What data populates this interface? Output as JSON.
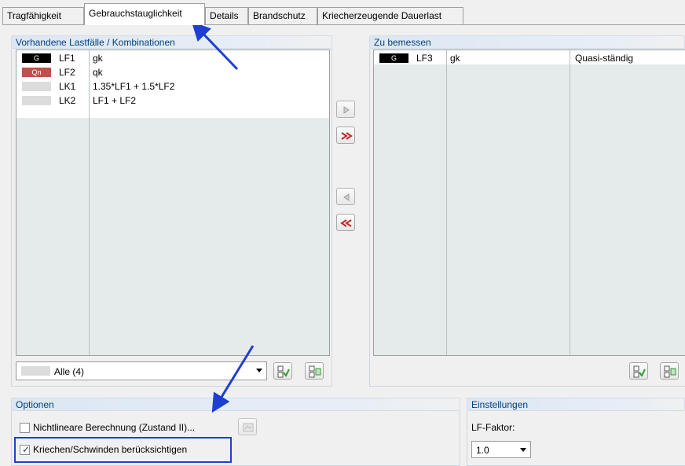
{
  "tabs": [
    {
      "label": "Tragfähigkeit"
    },
    {
      "label": "Gebrauchstauglichkeit"
    },
    {
      "label": "Details"
    },
    {
      "label": "Brandschutz"
    },
    {
      "label": "Kriecherzeugende Dauerlast"
    }
  ],
  "available": {
    "header": "Vorhandene Lastfälle / Kombinationen",
    "rows": [
      {
        "badge": "G",
        "id": "LF1",
        "desc": "gk"
      },
      {
        "badge": "Qn",
        "id": "LF2",
        "desc": "qk"
      },
      {
        "badge": "",
        "id": "LK1",
        "desc": "1.35*LF1 + 1.5*LF2"
      },
      {
        "badge": "",
        "id": "LK2",
        "desc": "LF1 + LF2"
      }
    ],
    "filter_value": "Alle (4)"
  },
  "design": {
    "header": "Zu bemessen",
    "rows": [
      {
        "badge": "G",
        "id": "LF3",
        "desc": "gk",
        "type": "Quasi-ständig"
      }
    ]
  },
  "options": {
    "header": "Optionen",
    "nonlinear_label": "Nichtlineare Berechnung (Zustand II)...",
    "nonlinear_checked": false,
    "creep_label": "Kriechen/Schwinden berücksichtigen",
    "creep_checked": true
  },
  "settings": {
    "header": "Einstellungen",
    "lf_factor_label": "LF-Faktor:",
    "lf_factor_value": "1.0"
  },
  "colors": {
    "accent_blue": "#1f3fd1",
    "header_text": "#003f7f",
    "badge_red": "#c0504d"
  }
}
